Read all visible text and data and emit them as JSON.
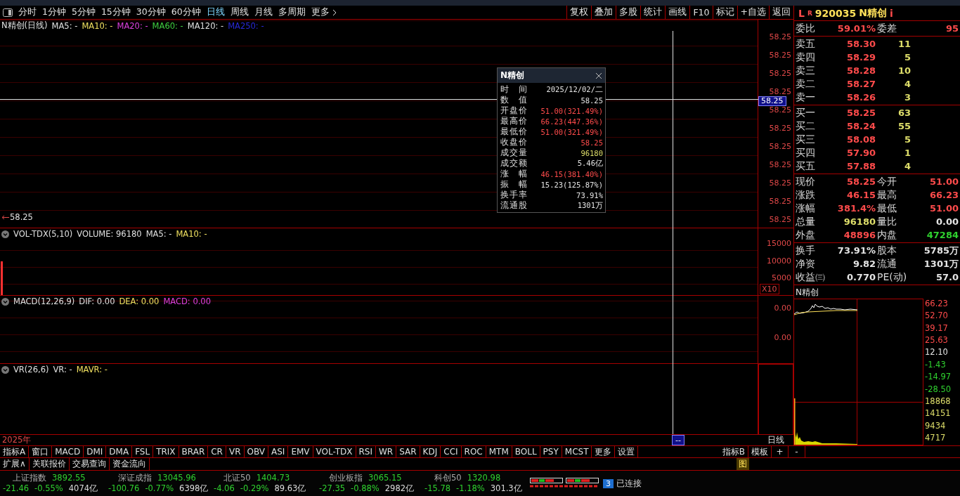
{
  "toolbar": {
    "periods": [
      {
        "label": "分时",
        "selected": false
      },
      {
        "label": "1分钟",
        "selected": false
      },
      {
        "label": "5分钟",
        "selected": false
      },
      {
        "label": "15分钟",
        "selected": false
      },
      {
        "label": "30分钟",
        "selected": false
      },
      {
        "label": "60分钟",
        "selected": false
      },
      {
        "label": "日线",
        "selected": true
      },
      {
        "label": "周线",
        "selected": false
      },
      {
        "label": "月线",
        "selected": false
      },
      {
        "label": "多周期",
        "selected": false
      },
      {
        "label": "更多",
        "selected": false
      }
    ],
    "actions": [
      "复权",
      "叠加",
      "多股",
      "统计",
      "画线",
      "F10",
      "标记",
      "+自选",
      "返回"
    ]
  },
  "price_pane": {
    "title": "N精创(日线)",
    "indicators": [
      {
        "label": "MA5: -",
        "color": "#e0e0e0"
      },
      {
        "label": "MA10: -",
        "color": "#f0e060"
      },
      {
        "label": "MA20: -",
        "color": "#e040e0"
      },
      {
        "label": "MA60: -",
        "color": "#40d040"
      },
      {
        "label": "MA120: -",
        "color": "#e0e0e0"
      },
      {
        "label": "MA250: -",
        "color": "#2828d8"
      }
    ],
    "axis_labels": [
      "58.25",
      "58.25",
      "58.25",
      "58.25",
      "58.25",
      "58.25",
      "58.25",
      "58.25",
      "58.25",
      "58.25",
      "58.25"
    ],
    "crosshair_price": "58.25",
    "last_price": "58.25"
  },
  "volume_pane": {
    "title": "VOL-TDX(5,10)",
    "indicators": [
      {
        "label": "VOLUME: 96180",
        "color": "#e0e0e0"
      },
      {
        "label": "MA5: -",
        "color": "#e0e0e0"
      },
      {
        "label": "MA10: -",
        "color": "#f0e060"
      }
    ],
    "axis_labels": [
      "15000",
      "10000",
      "5000"
    ],
    "scale": "X10"
  },
  "macd_pane": {
    "title": "MACD(12,26,9)",
    "indicators": [
      {
        "label": "DIF: 0.00",
        "color": "#e0e0e0"
      },
      {
        "label": "DEA: 0.00",
        "color": "#f0e060"
      },
      {
        "label": "MACD: 0.00",
        "color": "#e040e0"
      }
    ],
    "axis_labels": [
      "0.00",
      "0.00"
    ]
  },
  "vr_pane": {
    "title": "VR(26,6)",
    "indicators": [
      {
        "label": "VR: -",
        "color": "#e0e0e0"
      },
      {
        "label": "MAVR: -",
        "color": "#f0e060"
      }
    ]
  },
  "tooltip": {
    "title": "N精创",
    "rows": [
      {
        "label": "时间",
        "value": "2025/12/02/二",
        "color": "#e4e4e4"
      },
      {
        "label": "数值",
        "value": "58.25",
        "color": "#e4e4e4"
      },
      {
        "label": "开盘价",
        "value": "51.00(321.49%)",
        "color": "#ff4b4b"
      },
      {
        "label": "最高价",
        "value": "66.23(447.36%)",
        "color": "#ff4b4b"
      },
      {
        "label": "最低价",
        "value": "51.00(321.49%)",
        "color": "#ff4b4b"
      },
      {
        "label": "收盘价",
        "value": "58.25",
        "color": "#ff4b4b"
      },
      {
        "label": "成交量",
        "value": "96180",
        "color": "#dede6a"
      },
      {
        "label": "成交额",
        "value": "5.46亿",
        "color": "#e4e4e4"
      },
      {
        "label": "涨幅",
        "value": "46.15(381.40%)",
        "color": "#ff4b4b"
      },
      {
        "label": "振幅",
        "value": "15.23(125.87%)",
        "color": "#e4e4e4"
      },
      {
        "label": "换手率",
        "value": "73.91%",
        "color": "#e4e4e4"
      },
      {
        "label": "流通股",
        "value": "1301万",
        "color": "#e4e4e4"
      }
    ]
  },
  "timeline": {
    "year": "2025年",
    "cursor_date": "--",
    "period": "日线"
  },
  "indicator_tabs": {
    "left": [
      "指标A",
      "窗口",
      "MACD",
      "DMI",
      "DMA",
      "FSL",
      "TRIX",
      "BRAR",
      "CR",
      "VR",
      "OBV",
      "ASI",
      "EMV",
      "VOL-TDX",
      "RSI",
      "WR",
      "SAR",
      "KDJ",
      "CCI",
      "ROC",
      "MTM",
      "BOLL",
      "PSY",
      "MCST",
      "更多",
      "设置"
    ],
    "right": [
      "指标B",
      "模板"
    ],
    "zoom": [
      "+",
      "-"
    ]
  },
  "extra_tabs": [
    "扩展∧",
    "关联报价",
    "交易查询",
    "资金流向"
  ],
  "chart_toggle": "图",
  "indices": [
    {
      "name": "上证指数",
      "value": "3892.55",
      "change": "-21.46",
      "pct": "-0.55%",
      "amount": "4074亿",
      "color": "#2fd12f"
    },
    {
      "name": "深证成指",
      "value": "13045.96",
      "change": "-100.76",
      "pct": "-0.77%",
      "amount": "6398亿",
      "color": "#2fd12f"
    },
    {
      "name": "北证50",
      "value": "1404.73",
      "change": "-4.06",
      "pct": "-0.29%",
      "amount": "89.63亿",
      "color": "#2fd12f"
    },
    {
      "name": "创业板指",
      "value": "3065.15",
      "change": "-27.35",
      "pct": "-0.88%",
      "amount": "2982亿",
      "color": "#2fd12f"
    },
    {
      "name": "科创50",
      "value": "1320.98",
      "change": "-15.78",
      "pct": "-1.18%",
      "amount": "301.3亿",
      "color": "#2fd12f"
    }
  ],
  "connection": {
    "count": "3",
    "label": "已连接"
  },
  "quote": {
    "header": {
      "market": "L",
      "flag": "R",
      "code": "920035",
      "name": "N精创",
      "info": "i"
    },
    "order_ratio": [
      {
        "label": "委比",
        "value": "59.01%",
        "color": "#ff4b4b"
      },
      {
        "label": "委差",
        "value": "95",
        "color": "#ff4b4b"
      }
    ],
    "asks": [
      {
        "label": "卖五",
        "price": "58.30",
        "volume": "11"
      },
      {
        "label": "卖四",
        "price": "58.29",
        "volume": "5"
      },
      {
        "label": "卖三",
        "price": "58.28",
        "volume": "10"
      },
      {
        "label": "卖二",
        "price": "58.27",
        "volume": "4"
      },
      {
        "label": "卖一",
        "price": "58.26",
        "volume": "3"
      }
    ],
    "bids": [
      {
        "label": "买一",
        "price": "58.25",
        "volume": "63"
      },
      {
        "label": "买二",
        "price": "58.24",
        "volume": "55"
      },
      {
        "label": "买三",
        "price": "58.08",
        "volume": "5"
      },
      {
        "label": "买四",
        "price": "57.90",
        "volume": "1"
      },
      {
        "label": "买五",
        "price": "57.88",
        "volume": "4"
      }
    ],
    "stats": [
      [
        {
          "label": "现价",
          "value": "58.25",
          "color": "#ff4b4b"
        },
        {
          "label": "今开",
          "value": "51.00",
          "color": "#ff4b4b"
        }
      ],
      [
        {
          "label": "涨跌",
          "value": "46.15",
          "color": "#ff4b4b"
        },
        {
          "label": "最高",
          "value": "66.23",
          "color": "#ff4b4b"
        }
      ],
      [
        {
          "label": "涨幅",
          "value": "381.4%",
          "color": "#ff4b4b"
        },
        {
          "label": "最低",
          "value": "51.00",
          "color": "#ff4b4b"
        }
      ],
      [
        {
          "label": "总量",
          "value": "96180",
          "color": "#dede6a"
        },
        {
          "label": "量比",
          "value": "0.00",
          "color": "#e4e4e4"
        }
      ],
      [
        {
          "label": "外盘",
          "value": "48896",
          "color": "#ff4b4b"
        },
        {
          "label": "内盘",
          "value": "47284",
          "color": "#2fd12f"
        }
      ]
    ],
    "fundamentals": [
      [
        {
          "label": "换手",
          "value": "73.91%",
          "color": "#e4e4e4"
        },
        {
          "label": "股本",
          "value": "5785万",
          "color": "#e4e4e4"
        }
      ],
      [
        {
          "label": "净资",
          "value": "9.82",
          "color": "#e4e4e4"
        },
        {
          "label": "流通",
          "value": "1301万",
          "color": "#e4e4e4"
        }
      ],
      [
        {
          "label": "收益㈢",
          "value": "0.770",
          "color": "#e4e4e4"
        },
        {
          "label": "PE(动)",
          "value": "57.0",
          "color": "#e4e4e4"
        }
      ]
    ]
  },
  "mini_chart": {
    "title": "N精创",
    "price_ticks": [
      {
        "label": "66.23",
        "color": "#ff4b4b"
      },
      {
        "label": "52.70",
        "color": "#ff4b4b"
      },
      {
        "label": "39.17",
        "color": "#ff4b4b"
      },
      {
        "label": "25.63",
        "color": "#ff4b4b"
      },
      {
        "label": "12.10",
        "color": "#e4e4e4"
      },
      {
        "label": "-1.43",
        "color": "#2fd12f"
      },
      {
        "label": "-14.97",
        "color": "#2fd12f"
      },
      {
        "label": "-28.50",
        "color": "#2fd12f"
      }
    ],
    "volume_ticks": [
      "18868",
      "14151",
      "9434",
      "4717"
    ]
  }
}
